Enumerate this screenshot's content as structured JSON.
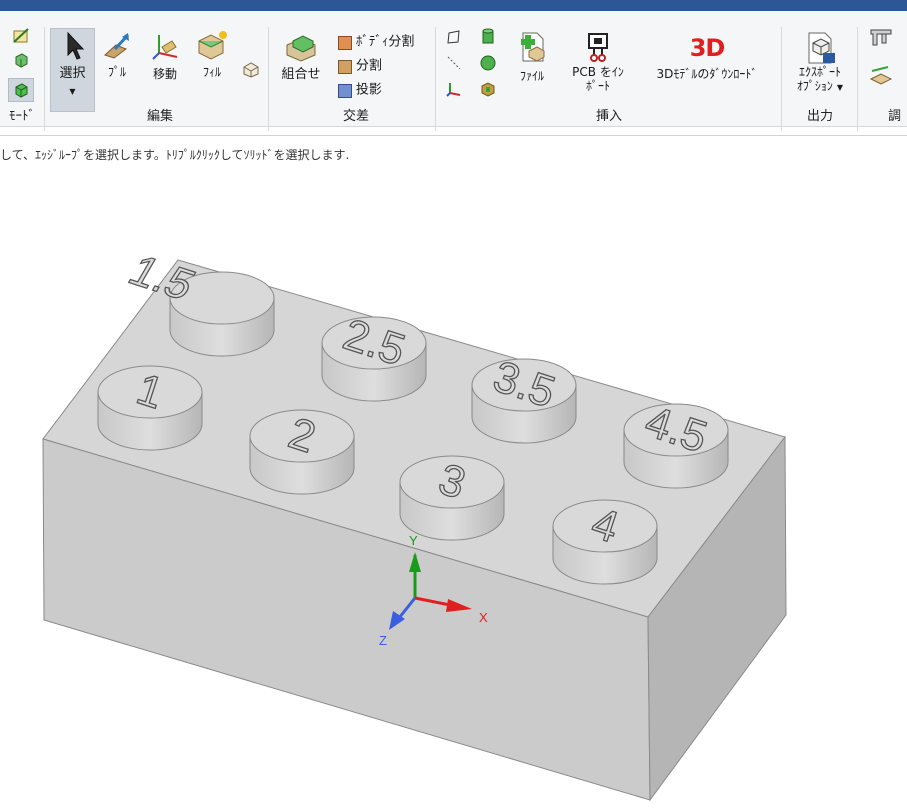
{
  "ribbon": {
    "mode_group_label": "ﾓｰﾄﾞ",
    "edit_group_label": "編集",
    "intersect_group_label": "交差",
    "insert_group_label": "挿入",
    "output_group_label": "出力",
    "adjust_group_label": "調",
    "select_label": "選択",
    "pull_label": "ﾌﾟﾙ",
    "move_label": "移動",
    "fill_label": "ﾌｨﾙ",
    "combine_label": "組合せ",
    "split_body_label": "ﾎﾞﾃﾞｨ分割",
    "split_label": "分割",
    "project_label": "投影",
    "file_label": "ﾌｧｲﾙ",
    "pcb_import_line1": "PCB をｲﾝ",
    "pcb_import_line2": "ﾎﾟｰﾄ",
    "model_download_label": "3Dﾓﾃﾞﾙのﾀﾞｳﾝﾛｰﾄﾞ",
    "export_options_line1": "ｴｸｽﾎﾟｰﾄ",
    "export_options_line2": "ｵﾌﾟｼｮﾝ",
    "badge_3d": "3D"
  },
  "status": {
    "hint": "して、ｴｯｼﾞﾙｰﾌﾟを選択します。ﾄﾘﾌﾟﾙｸﾘｯｸしてｿﾘｯﾄﾞを選択します."
  },
  "viewport": {
    "stud_labels": [
      "1.5",
      "2.5",
      "3.5",
      "4.5",
      "1",
      "2",
      "3",
      "4"
    ],
    "axis_x": "X",
    "axis_y": "Y",
    "axis_z": "Z",
    "colors": {
      "axis_x": "#e02020",
      "axis_y": "#1a9a1a",
      "axis_z": "#3a5ee0",
      "brick": "#d0d0d0"
    }
  }
}
